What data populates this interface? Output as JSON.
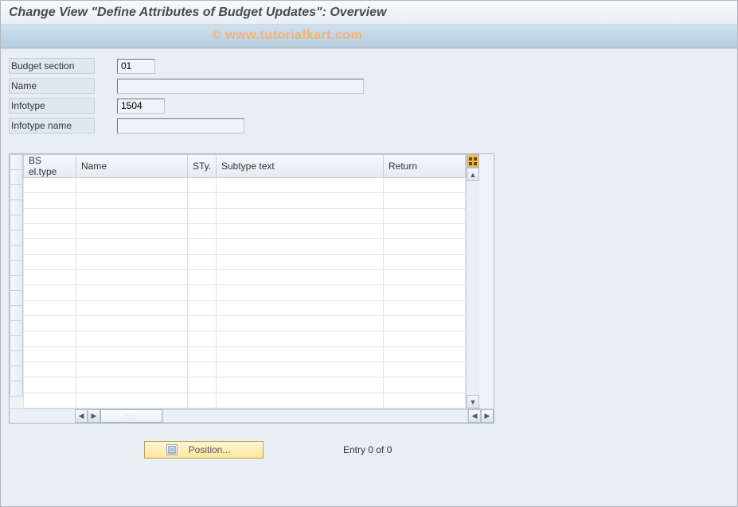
{
  "title": "Change View \"Define Attributes of Budget Updates\": Overview",
  "watermark": "© www.tutorialkart.com",
  "form": {
    "budget_section": {
      "label": "Budget section",
      "value": "01"
    },
    "name": {
      "label": "Name",
      "value": ""
    },
    "infotype": {
      "label": "Infotype",
      "value": "1504"
    },
    "infotype_name": {
      "label": "Infotype name",
      "value": ""
    }
  },
  "table": {
    "columns": {
      "c0": "BS el.type",
      "c1": "Name",
      "c2": "STy.",
      "c3": "Subtype text",
      "c4": "Return"
    },
    "row_count": 15
  },
  "footer": {
    "position_label": "Position...",
    "status": "Entry 0 of 0"
  }
}
